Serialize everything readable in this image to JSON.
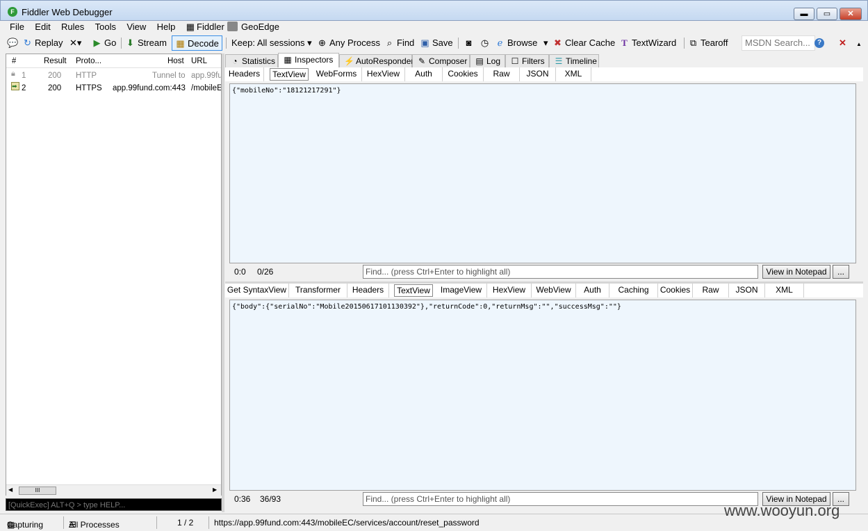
{
  "window": {
    "title": "Fiddler Web Debugger",
    "minimize": "▬",
    "maximize": "▭",
    "close": "✕"
  },
  "menu": [
    "File",
    "Edit",
    "Rules",
    "Tools",
    "View",
    "Help",
    "Fiddler"
  ],
  "geoedge": "GeoEdge",
  "toolbar": {
    "replay": "Replay",
    "remove": "✕▾",
    "go": "Go",
    "stream": "Stream",
    "decode": "Decode",
    "keep": "Keep: All sessions ▾",
    "any_process": "Any Process",
    "find": "Find",
    "save": "Save",
    "browse": "Browse",
    "browse_arrow": "▾",
    "clear_cache": "Clear Cache",
    "text_wizard": "TextWizard",
    "tearoff": "Tearoff",
    "msdn_search": "MSDN Search...",
    "help": "?",
    "close_x": "✕"
  },
  "sessions": {
    "columns": [
      "#",
      "Result",
      "Proto...",
      "Host",
      "URL"
    ],
    "rows": [
      {
        "num": "1",
        "result": "200",
        "proto": "HTTP",
        "host": "Tunnel to",
        "url": "app.99fu"
      },
      {
        "num": "2",
        "result": "200",
        "proto": "HTTPS",
        "host": "app.99fund.com:443",
        "url": "/mobileEC"
      }
    ],
    "scroll_thumb": "III"
  },
  "quickexec": "[QuickExec] ALT+Q > type HELP...",
  "main_tabs": [
    "Statistics",
    "Inspectors",
    "AutoResponder",
    "Composer",
    "Log",
    "Filters",
    "Timeline"
  ],
  "request": {
    "tabs": [
      "Headers",
      "TextView",
      "WebForms",
      "HexView",
      "Auth",
      "Cookies",
      "Raw",
      "JSON",
      "XML"
    ],
    "active_tab": "TextView",
    "body": "{\"mobileNo\":\"18121217291\"}",
    "pos": "0:0",
    "count": "0/26",
    "find_placeholder": "Find... (press Ctrl+Enter to highlight all)",
    "view_notepad": "View in Notepad",
    "more": "..."
  },
  "response": {
    "tabs": [
      "Get SyntaxView",
      "Transformer",
      "Headers",
      "TextView",
      "ImageView",
      "HexView",
      "WebView",
      "Auth",
      "Caching",
      "Cookies",
      "Raw",
      "JSON",
      "XML"
    ],
    "active_tab": "TextView",
    "body": "{\"body\":{\"serialNo\":\"Mobile20150617101130392\"},\"returnCode\":0,\"returnMsg\":\"\",\"successMsg\":\"\"}",
    "pos": "0:36",
    "count": "36/93",
    "find_placeholder": "Find... (press Ctrl+Enter to highlight all)",
    "view_notepad": "View in Notepad",
    "more": "..."
  },
  "statusbar": {
    "capturing": "Capturing",
    "processes": "All Processes",
    "count": "1 / 2",
    "url": "https://app.99fund.com:443/mobileEC/services/account/reset_password"
  },
  "watermark": "www.wooyun.org",
  "colors": {
    "content_bg": "#eef6fd",
    "title_gradient_top": "#dbe8f7",
    "decode_highlight": "#3a8ee6"
  }
}
